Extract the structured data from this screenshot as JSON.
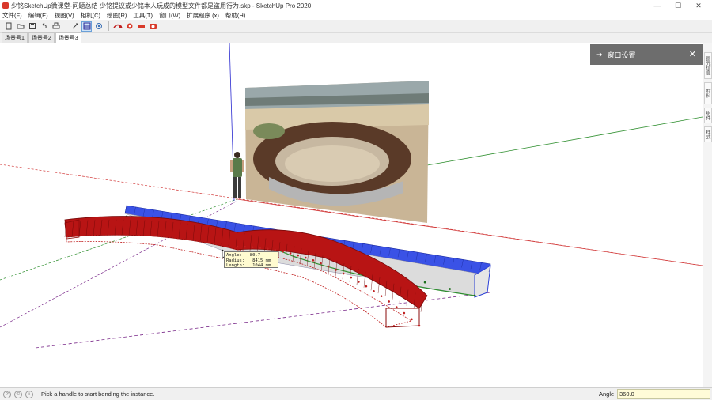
{
  "window": {
    "title": "少铭SketchUp微课堂-问题总结·少铭提议或少铭本人玩成的模型文件都是盗用行为.skp - SketchUp Pro 2020",
    "minimize": "—",
    "maximize": "☐",
    "close": "✕"
  },
  "menu": {
    "items": [
      "文件(F)",
      "编辑(E)",
      "视图(V)",
      "相机(C)",
      "绘图(R)",
      "工具(T)",
      "窗口(W)",
      "扩展程序 (x)",
      "帮助(H)"
    ]
  },
  "scenes": {
    "tabs": [
      "场景号1",
      "场景号2",
      "场景号3"
    ],
    "active_index": 2
  },
  "panel": {
    "label": "窗口设置",
    "arrow": "➔",
    "close": "✕",
    "color": "#6d6d6d"
  },
  "right_tabs": [
    "图元信息",
    "材料",
    "组件",
    "样式"
  ],
  "tooltip": {
    "angle": "Angle:   80.7",
    "radius": "Radius:   8415 mm",
    "length": "Length:   1044 mm"
  },
  "status": {
    "hint": "Pick a handle to start bending the instance.",
    "vcb_label": "Angle",
    "vcb_value": "360.0"
  },
  "colors": {
    "bench_red": "#a31010",
    "bench_blue": "#2a3fd6",
    "axis_red": "#d23b3b",
    "axis_green": "#2f8f2f",
    "axis_blue": "#2a2ad0",
    "guide_purple": "#7a2a8a"
  }
}
